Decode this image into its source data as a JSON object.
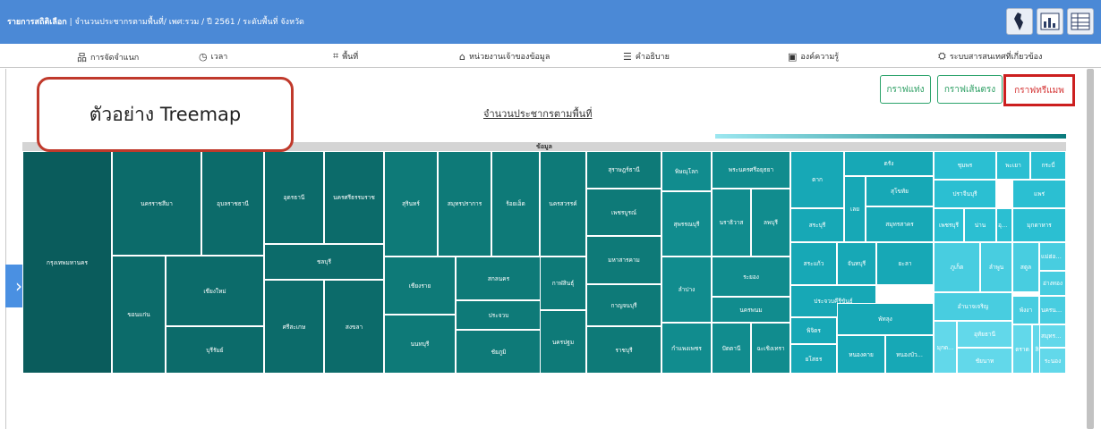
{
  "header": {
    "title_bold": "รายการสถิติเลือก",
    "title_rest": " | จำนวนประชากรตามพื้นที่/ เพศ:รวม / ปี 2561 / ระดับพื้นที่ จังหวัด"
  },
  "menu": [
    {
      "label": "การจัดจำแนก",
      "icon": "hierarchy-icon",
      "glyph": "品"
    },
    {
      "label": "เวลา",
      "icon": "clock-icon",
      "glyph": "◷"
    },
    {
      "label": "พื้นที่",
      "icon": "map-area-icon",
      "glyph": "⌗"
    },
    {
      "label": "หน่วยงานเจ้าของข้อมูล",
      "icon": "building-icon",
      "glyph": "⌂"
    },
    {
      "label": "คำอธิบาย",
      "icon": "document-icon",
      "glyph": "☰"
    },
    {
      "label": "องค์ความรู้",
      "icon": "book-icon",
      "glyph": "▣"
    },
    {
      "label": "ระบบสารสนเทศที่เกี่ยวข้อง",
      "icon": "info-system-icon",
      "glyph": "⛭"
    }
  ],
  "callout": "ตัวอย่าง Treemap",
  "chart_title": "จำนวนประชากรตามพื้นที่",
  "buttons": {
    "bar": "กราฟแท่ง",
    "line": "กราฟเส้นตรง",
    "treemap": "กราฟทรีแมพ"
  },
  "colors": {
    "header": "#4b89d6",
    "accent_green": "#2ba36b",
    "highlight_red": "#cc1f1f",
    "treemap_dark": "#0b5f5f",
    "treemap_light": "#5fd0e8"
  },
  "chart_data": {
    "type": "treemap",
    "title": "จำนวนประชากรตามพื้นที่",
    "root_label": "ข้อมูล",
    "items": [
      "กรุงเทพมหานคร",
      "นครราชสีมา",
      "อุบลราชธานี",
      "ขอนแก่น",
      "เชียงใหม่",
      "บุรีรัมย์",
      "อุดรธานี",
      "นครศรีธรรมราช",
      "ชลบุรี",
      "ศรีสะเกษ",
      "สงขลา",
      "สุรินทร์",
      "สมุทรปราการ",
      "ร้อยเอ็ด",
      "นครสวรรค์",
      "เชียงราย",
      "สกลนคร",
      "ประจวบ",
      "นนทบุรี",
      "ชัยภูมิ",
      "สุราษฎร์ธานี",
      "เพชรบูรณ์",
      "กาฬสินธุ์",
      "มหาสารคาม",
      "กาญจนบุรี",
      "นครปฐม",
      "ราชบุรี",
      "พิษณุโลก",
      "พระนครศรีอยุธยา",
      "สุพรรณบุรี",
      "นราธิวาส",
      "ลพบุรี",
      "ลำปาง",
      "ระยอง",
      "นครพนม",
      "กำแพงเพชร",
      "ปัตตานี",
      "ฉะเชิงเทรา",
      "ตาก",
      "เลย",
      "สระบุรี",
      "ตรัง",
      "สุโขทัย",
      "สมุทรสาคร",
      "สระแก้ว",
      "จันทบุรี",
      "ยะลา",
      "ประจวบคีรีขันธ์",
      "พัทลุง",
      "พิจิตร",
      "หนองคาย",
      "หนองบัว...",
      "ยโสธร",
      "ชุมพร",
      "ปราจีนบุรี",
      "เพชรบุรี",
      "น่าน",
      "อุตร...",
      "พะเยา",
      "กระบี่",
      "แพร่",
      "มุกดาหาร",
      "ภูเก็ต",
      "ลำพูน",
      "สตูล",
      "แม่ฮ่องสอน",
      "อ่างทอง",
      "อำนาจเจริญ",
      "พังงา",
      "นครนายก",
      "มุกด...",
      "อุทัยธานี",
      "ชัยนาท",
      "ตราด",
      "สิง...",
      "สมุทรส...",
      "ระนอง"
    ]
  }
}
